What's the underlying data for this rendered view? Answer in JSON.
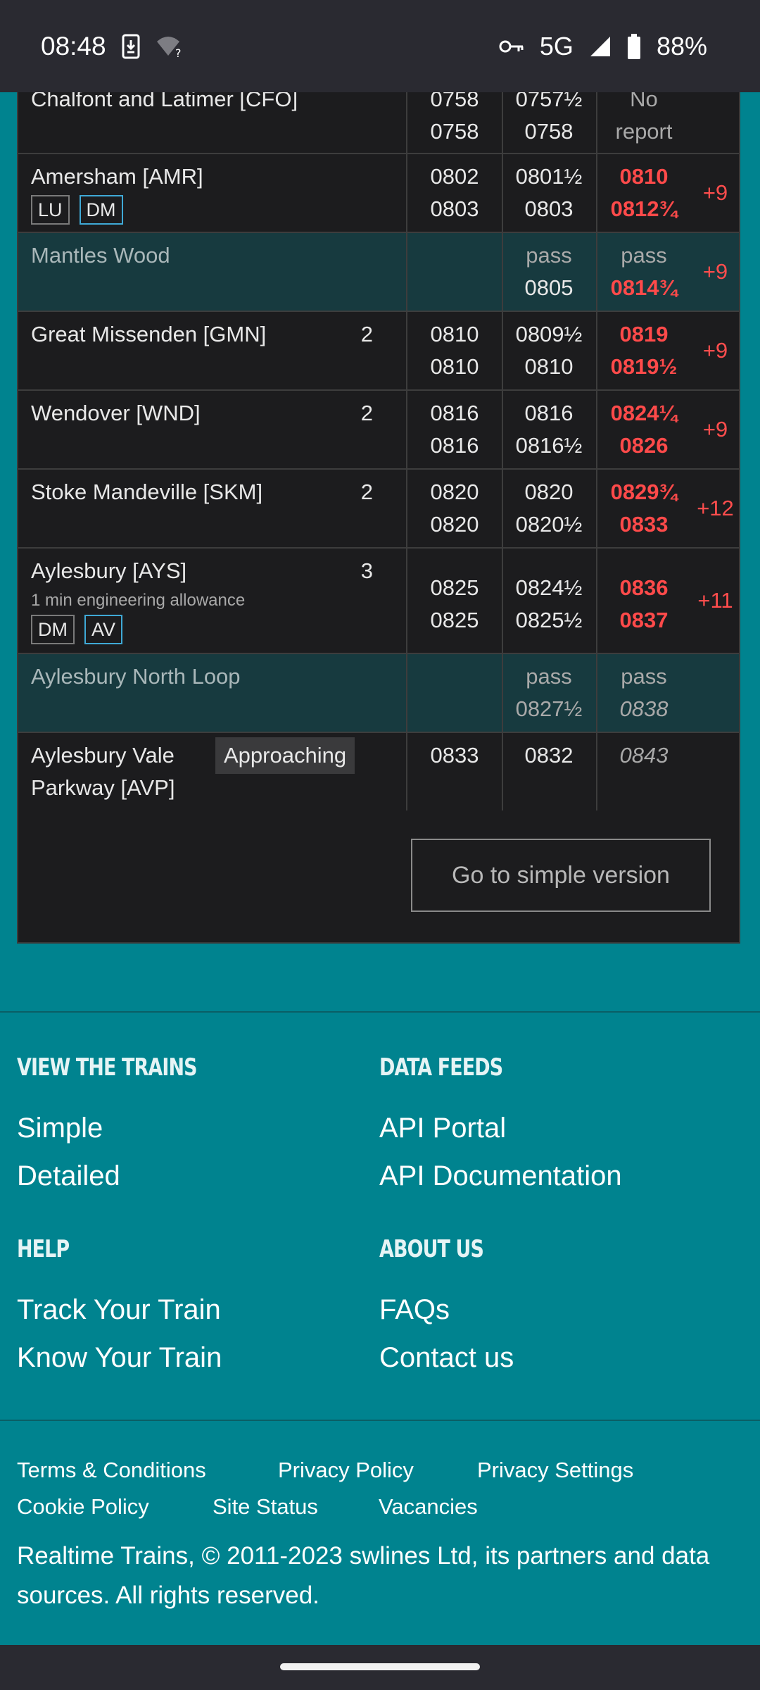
{
  "status_bar": {
    "time": "08:48",
    "network": "5G",
    "battery": "88%",
    "icons": [
      "download-icon",
      "wifi-question-icon",
      "vpn-key-icon",
      "signal-icon",
      "battery-icon"
    ]
  },
  "timetable": {
    "rows": [
      {
        "location": "Chalfont and Latimer [CFO]",
        "platform": "",
        "plan_arr": "0758",
        "plan_dep": "0758",
        "wtt_arr": "0757½",
        "wtt_dep": "0758",
        "act1": "No",
        "act2": "report",
        "delay": ""
      },
      {
        "location": "Amersham [AMR]",
        "platform": "",
        "badges": [
          "LU",
          "DM"
        ],
        "plan_arr": "0802",
        "plan_dep": "0803",
        "wtt_arr": "0801½",
        "wtt_dep": "0803",
        "act1": "0810",
        "act2": "0812¾",
        "delay": "+9"
      },
      {
        "location": "Mantles Wood",
        "platform": "",
        "plan_arr": "",
        "plan_dep": "",
        "wtt_arr": "pass",
        "wtt_dep": "0805",
        "act1": "pass",
        "act2": "0814¾",
        "delay": "+9"
      },
      {
        "location": "Great Missenden [GMN]",
        "platform": "2",
        "plan_arr": "0810",
        "plan_dep": "0810",
        "wtt_arr": "0809½",
        "wtt_dep": "0810",
        "act1": "0819",
        "act2": "0819½",
        "delay": "+9"
      },
      {
        "location": "Wendover [WND]",
        "platform": "2",
        "plan_arr": "0816",
        "plan_dep": "0816",
        "wtt_arr": "0816",
        "wtt_dep": "0816½",
        "act1": "0824¼",
        "act2": "0826",
        "delay": "+9"
      },
      {
        "location": "Stoke Mandeville [SKM]",
        "platform": "2",
        "plan_arr": "0820",
        "plan_dep": "0820",
        "wtt_arr": "0820",
        "wtt_dep": "0820½",
        "act1": "0829¾",
        "act2": "0833",
        "delay": "+12"
      },
      {
        "location": "Aylesbury [AYS]",
        "platform": "3",
        "note": "1 min engineering allowance",
        "badges": [
          "DM",
          "AV"
        ],
        "plan_arr": "0825",
        "plan_dep": "0825",
        "wtt_arr": "0824½",
        "wtt_dep": "0825½",
        "act1": "0836",
        "act2": "0837",
        "delay": "+11"
      },
      {
        "location": "Aylesbury North Loop",
        "platform": "",
        "plan_arr": "",
        "plan_dep": "",
        "wtt_arr": "pass",
        "wtt_dep": "0827½",
        "act1": "pass",
        "act2": "0838",
        "delay": ""
      },
      {
        "location_line1": "Aylesbury Vale",
        "location_line2": "Parkway [AVP]",
        "status": "Approaching",
        "plan_arr": "0833",
        "wtt_arr": "0832",
        "act1": "0843"
      }
    ],
    "simple_button": "Go to simple version"
  },
  "footer": {
    "view_heading": "VIEW THE TRAINS",
    "view_links": [
      "Simple",
      "Detailed"
    ],
    "feeds_heading": "DATA FEEDS",
    "feeds_links": [
      "API Portal",
      "API Documentation"
    ],
    "help_heading": "HELP",
    "help_links": [
      "Track Your Train",
      "Know Your Train"
    ],
    "about_heading": "ABOUT US",
    "about_links": [
      "FAQs",
      "Contact us"
    ],
    "legal_links": [
      "Terms & Conditions",
      "Privacy Policy",
      "Privacy Settings",
      "Cookie Policy",
      "Site Status",
      "Vacancies"
    ],
    "copyright": "Realtime Trains, © 2011-2023 swlines Ltd, its partners and data sources. All rights reserved."
  },
  "colors": {
    "background": "#00838f",
    "panel": "#1c1c1e",
    "pass_row": "#173a3f",
    "late": "#ff4a4a"
  }
}
